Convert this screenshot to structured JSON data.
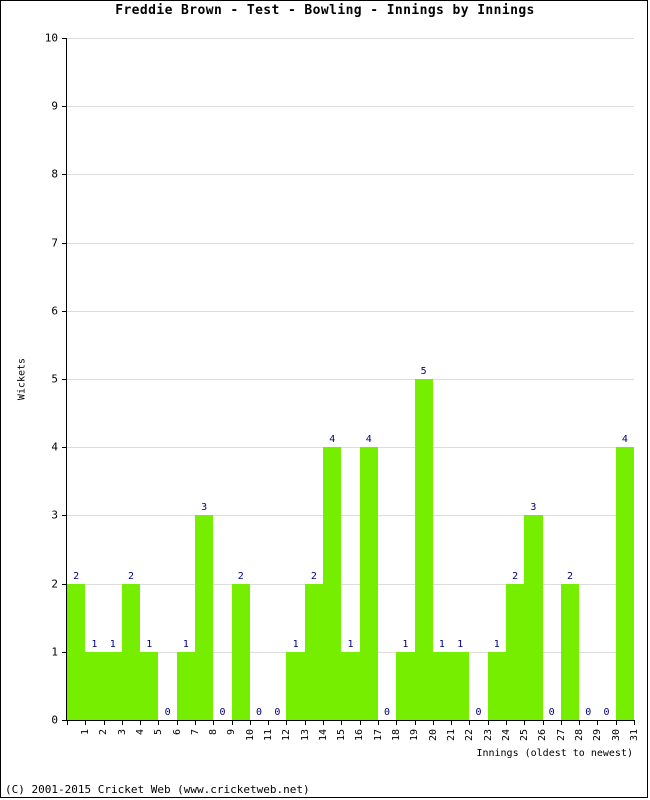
{
  "chart_data": {
    "type": "bar",
    "title": "Freddie Brown - Test - Bowling - Innings by Innings",
    "xlabel": "Innings (oldest to newest)",
    "ylabel": "Wickets",
    "categories": [
      "1",
      "2",
      "3",
      "4",
      "5",
      "6",
      "7",
      "8",
      "9",
      "10",
      "11",
      "12",
      "13",
      "14",
      "15",
      "16",
      "17",
      "18",
      "19",
      "20",
      "21",
      "22",
      "23",
      "24",
      "25",
      "26",
      "27",
      "28",
      "29",
      "30",
      "31"
    ],
    "values": [
      2,
      1,
      1,
      2,
      1,
      0,
      1,
      3,
      0,
      2,
      0,
      0,
      1,
      2,
      4,
      1,
      4,
      0,
      1,
      5,
      1,
      1,
      0,
      1,
      2,
      3,
      0,
      2,
      0,
      0,
      4
    ],
    "ylim": [
      0,
      10
    ],
    "yticks": [
      0,
      1,
      2,
      3,
      4,
      5,
      6,
      7,
      8,
      9,
      10
    ],
    "grid": true,
    "legend": "none",
    "bar_color": "#76ee00",
    "label_color": "#000080"
  },
  "footer": {
    "copyright": "(C) 2001-2015 Cricket Web (www.cricketweb.net)"
  }
}
